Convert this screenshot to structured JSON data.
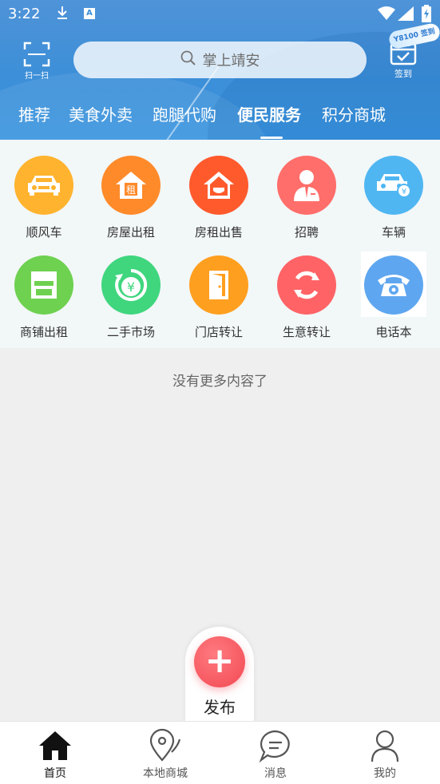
{
  "status_bar": {
    "time": "3:22",
    "download_icon": "download-icon",
    "a_badge": "A",
    "wifi_icon": "wifi-icon",
    "signal_icon": "signal-icon",
    "battery_icon": "battery-charging-icon"
  },
  "header": {
    "scan_label": "扫一扫",
    "search_placeholder": "掌上靖安",
    "checkin_label": "签到",
    "floating_badge": "Y8100 签到"
  },
  "tabs": [
    {
      "label": "推荐",
      "active": false
    },
    {
      "label": "美食外卖",
      "active": false
    },
    {
      "label": "跑腿代购",
      "active": false
    },
    {
      "label": "便民服务",
      "active": true
    },
    {
      "label": "积分商城",
      "active": false
    }
  ],
  "services": [
    {
      "label": "顺风车",
      "icon": "car-icon",
      "color": "#ffb32e"
    },
    {
      "label": "房屋出租",
      "icon": "house-rent-icon",
      "color": "#ff8a2a"
    },
    {
      "label": "房租出售",
      "icon": "house-sale-icon",
      "color": "#ff5a2c"
    },
    {
      "label": "招聘",
      "icon": "recruit-person-icon",
      "color": "#ff6e6a"
    },
    {
      "label": "车辆",
      "icon": "car-money-icon",
      "color": "#4fb6f2"
    },
    {
      "label": "商铺出租",
      "icon": "shop-icon",
      "color": "#6ed150"
    },
    {
      "label": "二手市场",
      "icon": "yuan-cycle-icon",
      "color": "#3fd67e"
    },
    {
      "label": "门店转让",
      "icon": "door-icon",
      "color": "#ff9f1f"
    },
    {
      "label": "生意转让",
      "icon": "refresh-icon",
      "color": "#ff6366"
    },
    {
      "label": "电话本",
      "icon": "telephone-icon",
      "color": "#5ea6f0"
    }
  ],
  "list_end_text": "没有更多内容了",
  "publish": {
    "label": "发布",
    "icon": "plus-icon"
  },
  "bottom_nav": [
    {
      "label": "首页",
      "icon": "home-icon",
      "active": true
    },
    {
      "label": "本地商城",
      "icon": "location-pin-icon",
      "active": false
    },
    {
      "label": "消息",
      "icon": "message-bubble-icon",
      "active": false
    },
    {
      "label": "我的",
      "icon": "user-icon",
      "active": false
    }
  ],
  "colors": {
    "header_blue": "#3c8fd8",
    "grid_bg": "#f2f7f8",
    "page_bg": "#efefef",
    "publish_red": "#f24952"
  }
}
